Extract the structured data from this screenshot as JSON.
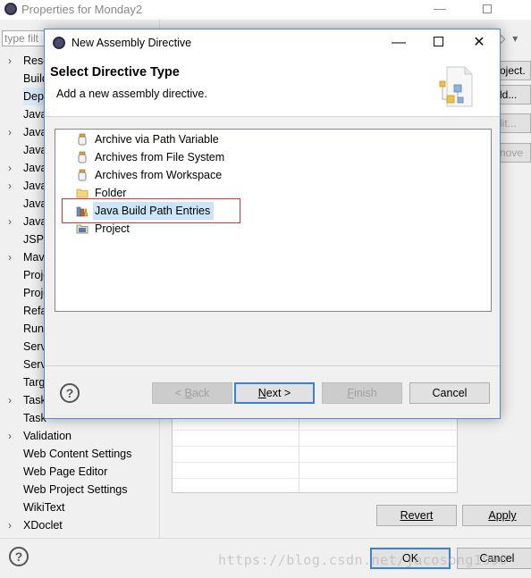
{
  "background_window": {
    "title": "Properties for Monday2",
    "filter_placeholder": "type filt",
    "tree_items": [
      {
        "label": "Reso",
        "expandable": true
      },
      {
        "label": "Build",
        "expandable": false
      },
      {
        "label": "Depl",
        "expandable": false,
        "selected": true
      },
      {
        "label": "Java",
        "expandable": false
      },
      {
        "label": "Java",
        "expandable": true
      },
      {
        "label": "Java",
        "expandable": false
      },
      {
        "label": "Java",
        "expandable": true
      },
      {
        "label": "Java",
        "expandable": true
      },
      {
        "label": "Java",
        "expandable": false
      },
      {
        "label": "Java",
        "expandable": true
      },
      {
        "label": "JSP",
        "expandable": false
      },
      {
        "label": "Mave",
        "expandable": true
      },
      {
        "label": "Proje",
        "expandable": false
      },
      {
        "label": "Proje",
        "expandable": false
      },
      {
        "label": "Refa",
        "expandable": false
      },
      {
        "label": "Run/",
        "expandable": false
      },
      {
        "label": "Serv",
        "expandable": false
      },
      {
        "label": "Serv",
        "expandable": false
      },
      {
        "label": "Targ",
        "expandable": false
      },
      {
        "label": "Task",
        "expandable": true
      },
      {
        "label": "Task",
        "expandable": false
      },
      {
        "label": "Validation",
        "expandable": true
      },
      {
        "label": "Web Content Settings",
        "expandable": false
      },
      {
        "label": "Web Page Editor",
        "expandable": false
      },
      {
        "label": "Web Project Settings",
        "expandable": false
      },
      {
        "label": "WikiText",
        "expandable": false
      },
      {
        "label": "XDoclet",
        "expandable": true
      }
    ],
    "right_buttons": [
      "oject.",
      "ld...",
      "lit...",
      "nove"
    ],
    "revert_label": "Revert",
    "apply_label": "Apply",
    "ok_label": "OK",
    "cancel_label": "Cancel",
    "watermark": "https://blog.csdn.net/jacosong1990"
  },
  "dialog": {
    "title": "New Assembly Directive",
    "header_title": "Select Directive Type",
    "header_description": "Add a new assembly directive.",
    "items": [
      {
        "label": "Archive via Path Variable",
        "icon": "jar-icon"
      },
      {
        "label": "Archives from File System",
        "icon": "jar-icon"
      },
      {
        "label": "Archives from Workspace",
        "icon": "jar-icon"
      },
      {
        "label": "Folder",
        "icon": "folder-icon"
      },
      {
        "label": "Java Build Path Entries",
        "icon": "library-icon",
        "selected": true
      },
      {
        "label": "Project",
        "icon": "project-icon"
      }
    ],
    "buttons": {
      "back": {
        "prefix": "< ",
        "mnemonic": "B",
        "rest": "ack"
      },
      "next": {
        "mnemonic": "N",
        "rest": "ext >"
      },
      "finish": {
        "mnemonic": "F",
        "rest": "inish"
      },
      "cancel": "Cancel"
    }
  },
  "colors": {
    "accent_border": "#3c7fd6",
    "selection": "#cce4f7",
    "highlight_box": "#e03030"
  }
}
